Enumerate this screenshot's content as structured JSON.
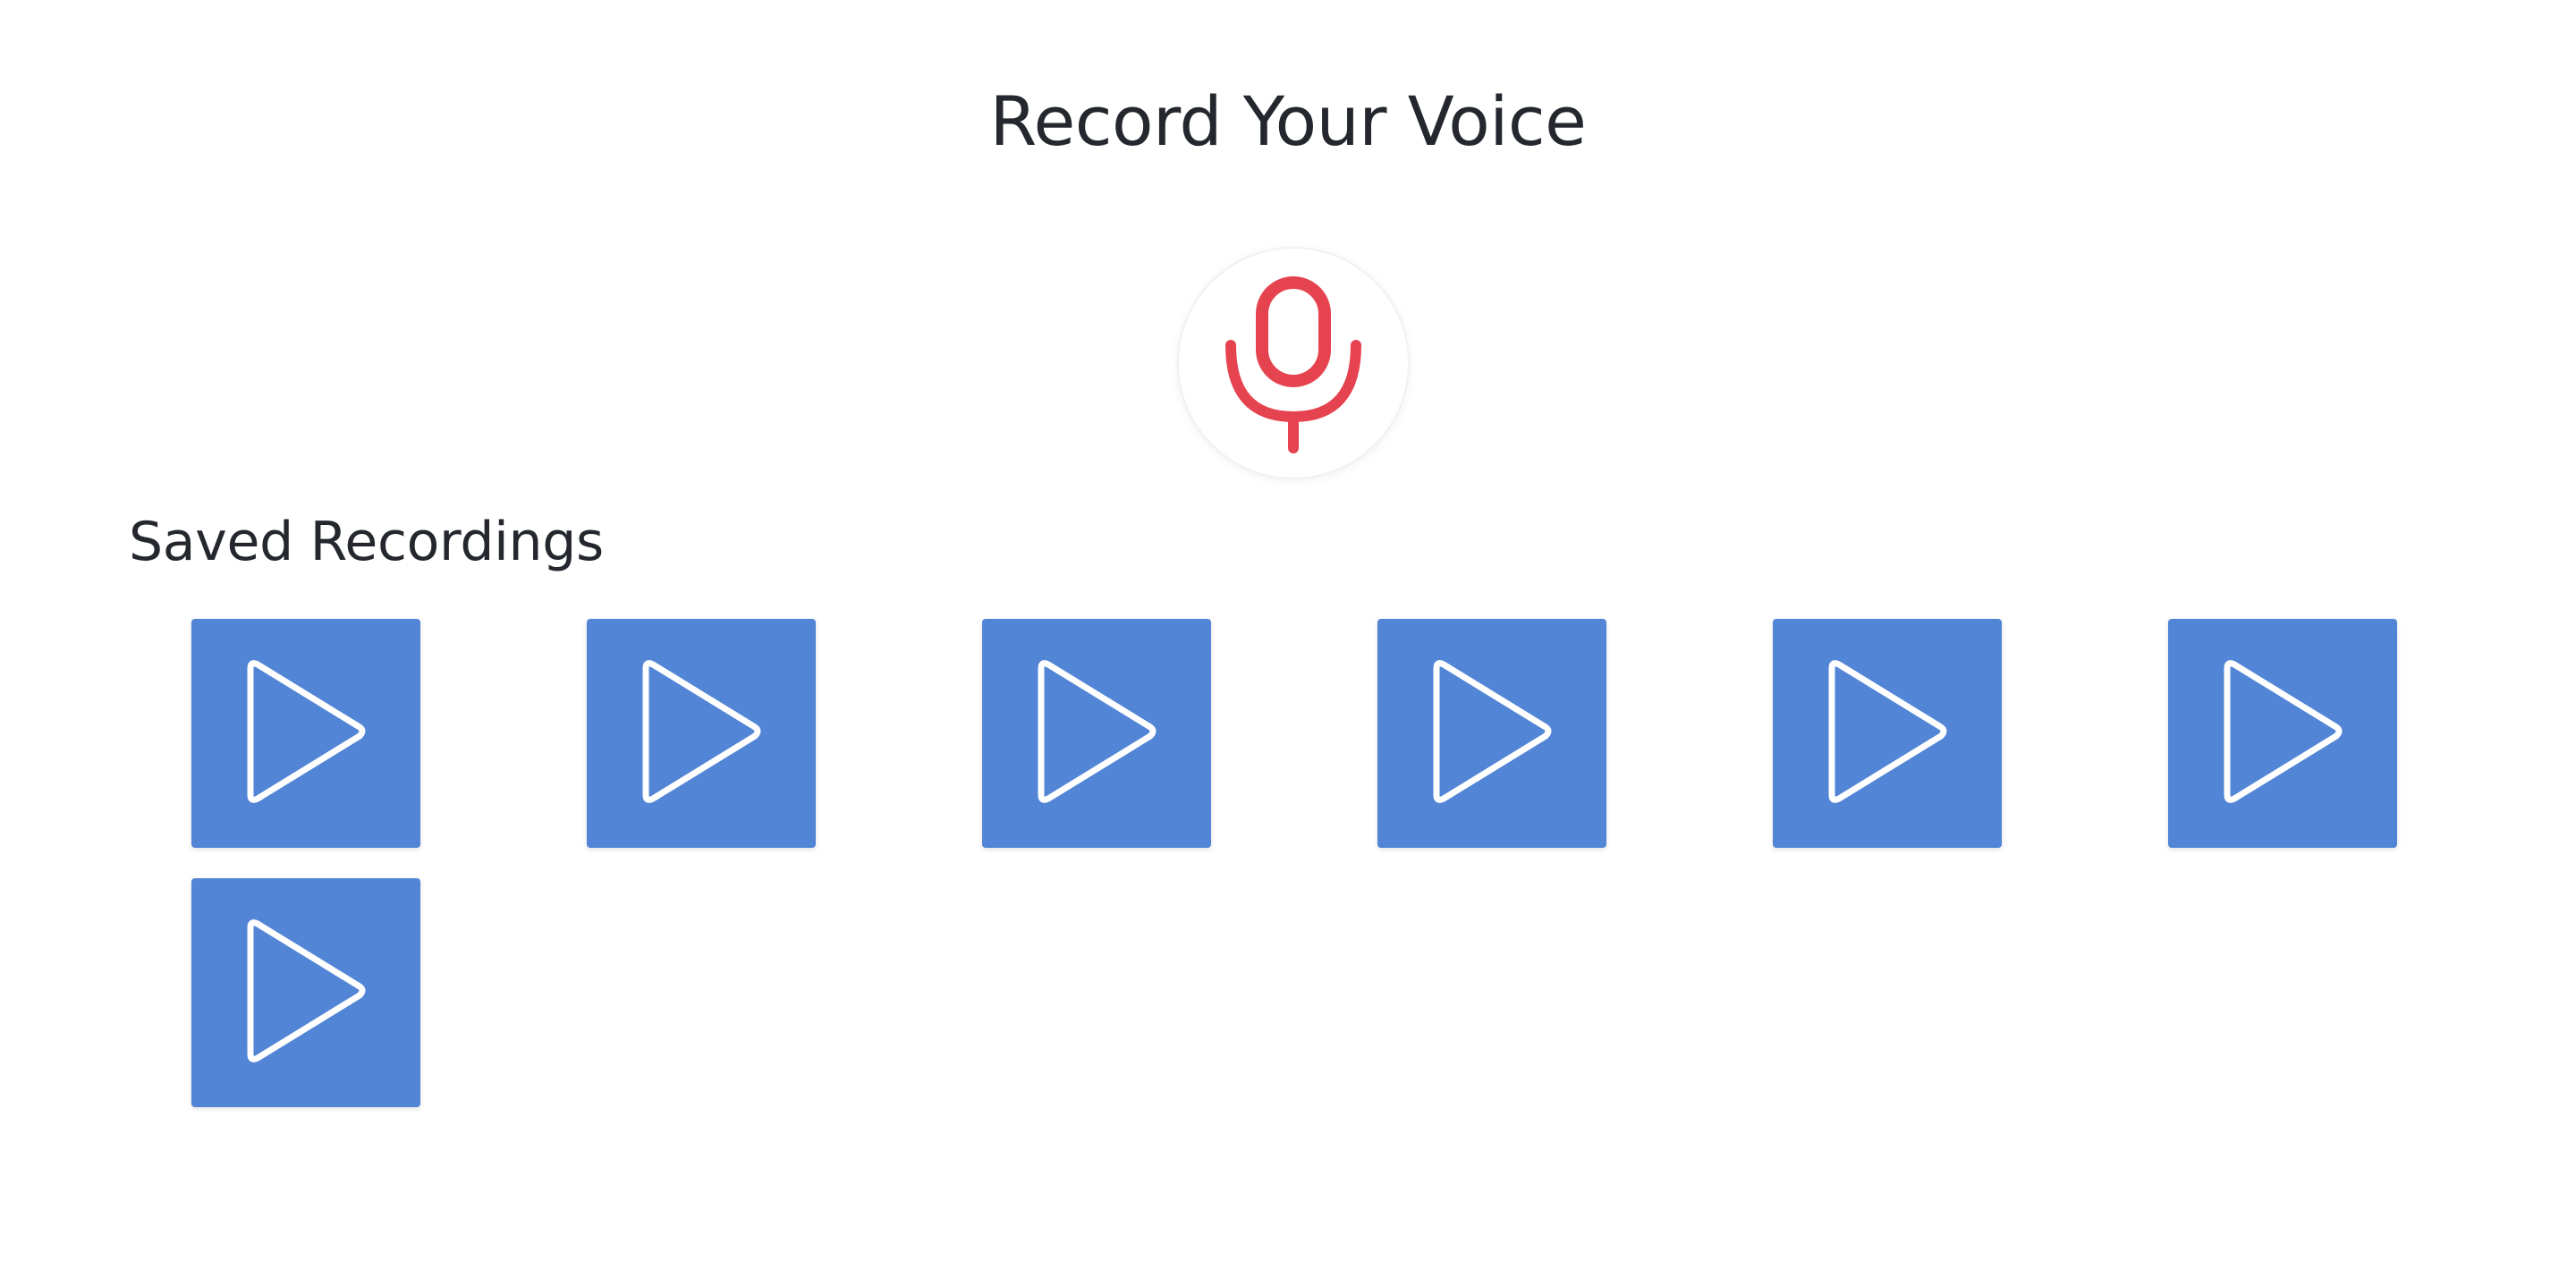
{
  "header": {
    "title": "Record Your Voice"
  },
  "recorder": {
    "icon": "microphone-icon",
    "icon_color": "#e5434f"
  },
  "recordings": {
    "section_title": "Saved Recordings",
    "tile_color": "#5285d6",
    "item_icon": "play-icon",
    "items": [
      {
        "icon": "play-icon"
      },
      {
        "icon": "play-icon"
      },
      {
        "icon": "play-icon"
      },
      {
        "icon": "play-icon"
      },
      {
        "icon": "play-icon"
      },
      {
        "icon": "play-icon"
      },
      {
        "icon": "play-icon"
      }
    ]
  }
}
